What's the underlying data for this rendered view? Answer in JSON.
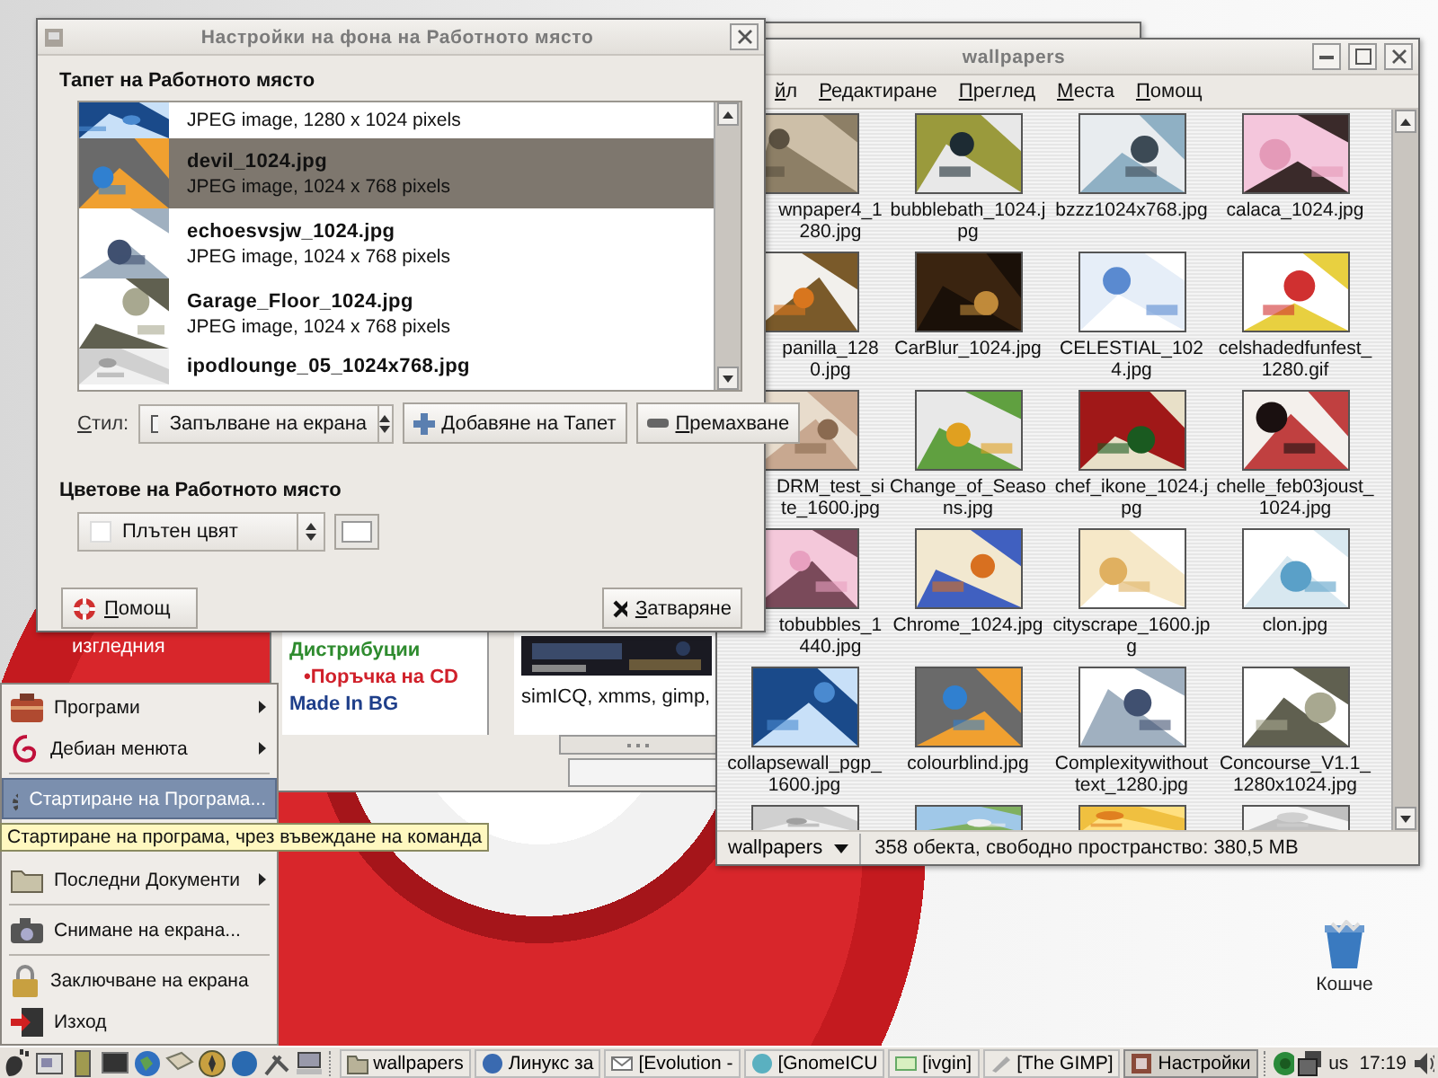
{
  "desktop": {
    "partial_label": "изгледния",
    "icons": [
      {
        "label": "Кошче"
      }
    ]
  },
  "background_window": {
    "links": [
      {
        "text": "Дистрибуции",
        "color": "#2e8b2e"
      },
      {
        "text": "•Поръчка на CD",
        "color": "#d0202a"
      },
      {
        "text": "Made In BG",
        "color": "#1f3f8a"
      }
    ],
    "caption": "simICQ, xmms, gimp,"
  },
  "dialog": {
    "title": "Настройки на фона на Работното място",
    "wallpaper_heading": "Тапет на Работното място",
    "wallpapers": [
      {
        "info": "JPEG image, 1280 x 1024 pixels",
        "selected": false
      },
      {
        "name": "devil_1024.jpg",
        "info": "JPEG image, 1024 x 768 pixels",
        "selected": true
      },
      {
        "name": "echoesvsjw_1024.jpg",
        "info": "JPEG image, 1024 x 768 pixels",
        "selected": false
      },
      {
        "name": "Garage_Floor_1024.jpg",
        "info": "JPEG image, 1024 x 768 pixels",
        "selected": false
      },
      {
        "name": "ipodlounge_05_1024x768.jpg",
        "selected": false
      }
    ],
    "style_label": "Стил:",
    "style_value": "Запълване на екрана",
    "add_button": "Добавяне на Тапет",
    "remove_button": "Премахване",
    "colors_heading": "Цветове на Работното място",
    "color_mode": "Плътен цвят",
    "help_button": "Помощ",
    "close_button": "Затваряне"
  },
  "file_manager": {
    "title": "wallpapers",
    "menu": [
      "йл",
      "Редактиране",
      "Преглед",
      "Места",
      "Помощ"
    ],
    "files": [
      {
        "label": "wnpaper4_1280.jpg"
      },
      {
        "label": "bubblebath_1024.jpg"
      },
      {
        "label": "bzzz1024x768.jpg"
      },
      {
        "label": "calaca_1024.jpg"
      },
      {
        "label": "panilla_1280.jpg"
      },
      {
        "label": "CarBlur_1024.jpg"
      },
      {
        "label": "CELESTIAL_1024.jpg"
      },
      {
        "label": "celshadedfunfest_1280.gif"
      },
      {
        "label": "DRM_test_site_1600.jpg"
      },
      {
        "label": "Change_of_Seasons.jpg"
      },
      {
        "label": "chef_ikone_1024.jpg"
      },
      {
        "label": "chelle_feb03joust_1024.jpg"
      },
      {
        "label": "tobubbles_1440.jpg"
      },
      {
        "label": "Chrome_1024.jpg"
      },
      {
        "label": "cityscrape_1600.jpg"
      },
      {
        "label": "clon.jpg"
      },
      {
        "label": "collapsewall_pgp_1600.jpg"
      },
      {
        "label": "colourblind.jpg"
      },
      {
        "label": "Complexitywithouttext_1280.jpg"
      },
      {
        "label": "Concourse_V1.1_1280x1024.jpg"
      }
    ],
    "location": "wallpapers",
    "status": "358 обекта, свободно пространство: 380,5 MB"
  },
  "start_menu": {
    "items": [
      {
        "kind": "item",
        "label": "Програми",
        "submenu": true,
        "selected": false
      },
      {
        "kind": "item",
        "label": "Дебиан менюта",
        "submenu": true,
        "selected": false
      },
      {
        "kind": "separator"
      },
      {
        "kind": "item",
        "label": "Стартиране на Програма...",
        "submenu": false,
        "selected": true
      },
      {
        "kind": "item",
        "label": "Последни Документи",
        "submenu": true,
        "selected": false
      },
      {
        "kind": "separator"
      },
      {
        "kind": "item",
        "label": "Снимане на екрана...",
        "submenu": false,
        "selected": false
      },
      {
        "kind": "separator"
      },
      {
        "kind": "item",
        "label": "Заключване на екрана",
        "submenu": false,
        "selected": false
      },
      {
        "kind": "item",
        "label": "Изход",
        "submenu": false,
        "selected": false
      }
    ],
    "tooltip": "Стартиране на програма, чрез въвеждане на команда"
  },
  "taskbar": {
    "tasks": [
      {
        "label": "wallpapers",
        "selected": false
      },
      {
        "label": "Линукс за",
        "selected": false
      },
      {
        "label": "[Evolution -",
        "selected": false
      },
      {
        "label": "[GnomeICU",
        "selected": false
      },
      {
        "label": "[ivgin]",
        "selected": false
      },
      {
        "label": "[The GIMP]",
        "selected": false
      },
      {
        "label": "Настройки",
        "selected": true
      }
    ],
    "keyboard_layout": "us",
    "clock": "17:19"
  }
}
